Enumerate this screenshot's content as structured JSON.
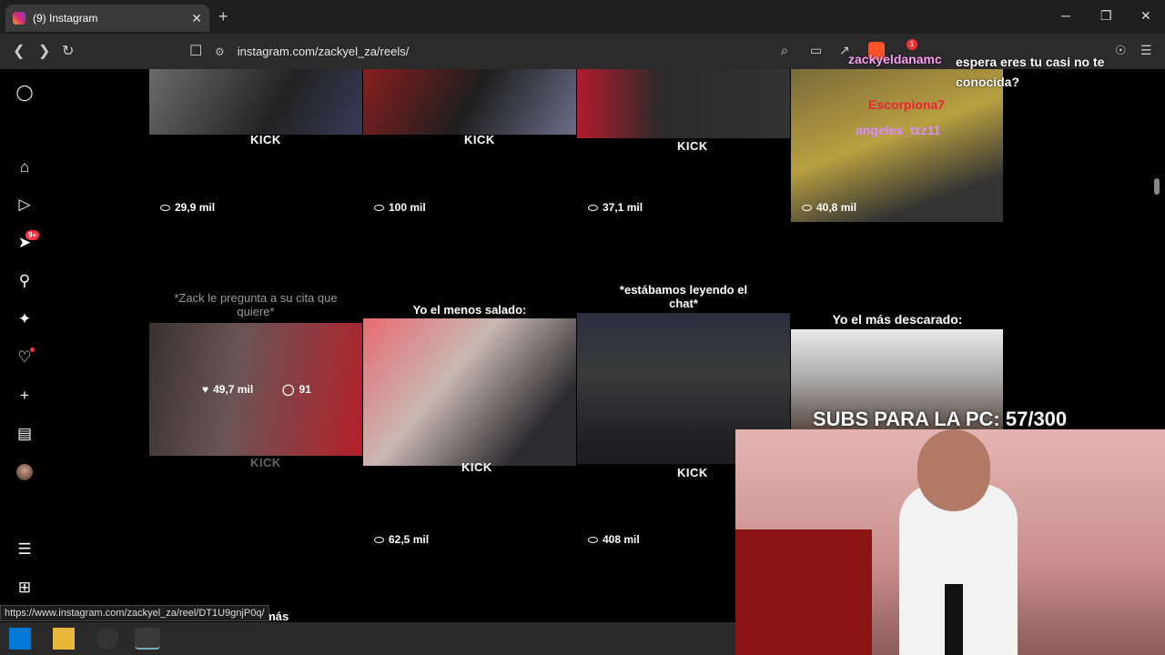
{
  "browser": {
    "tab_title": "(9) Instagram",
    "tab_close": "✕",
    "new_tab": "+",
    "url": "instagram.com/zackyel_za/reels/",
    "status_url": "https://www.instagram.com/zackyel_za/reel/DT1U9gnjP0q/",
    "ext_badge": "1",
    "win_min": "─",
    "win_max": "❐",
    "win_close": "✕"
  },
  "sidebar": {
    "notification_count": "9+",
    "icons": [
      "instagram-icon",
      "home-icon",
      "reels-icon",
      "messages-icon",
      "search-icon",
      "explore-icon",
      "notifications-icon",
      "create-icon",
      "dashboard-icon",
      "profile-avatar",
      "menu-icon",
      "also-from-meta-icon"
    ]
  },
  "grid": {
    "row1": [
      {
        "views": "29,9 mil",
        "brand": "KICK"
      },
      {
        "views": "100 mil",
        "brand": "KICK"
      },
      {
        "views": "37,1 mil",
        "brand": "KICK"
      },
      {
        "views": "40,8 mil"
      }
    ],
    "row2": [
      {
        "caption": "*Zack le pregunta a su cita que quiere*",
        "likes": "49,7 mil",
        "comments": "91",
        "brand": "KICK"
      },
      {
        "caption": "Yo el menos salado:",
        "views": "62,5 mil",
        "brand": "KICK"
      },
      {
        "caption": "*estábamos leyendo el chat*",
        "views": "408 mil",
        "brand": "KICK"
      },
      {
        "caption": "Yo el más descarado:"
      }
    ],
    "row3_partial": "l más"
  },
  "overlay": {
    "chat_user": "zackyeldanamc",
    "chat_message": "espera eres tu casi no te conocida?",
    "chat_name_1": "Escorpiona7",
    "chat_name_2": "angeles_tzz11",
    "subs_text": "SUBS PARA LA PC: 57/300"
  },
  "colors": {
    "chat_user": "#ff9ef2",
    "notification": "#ff3040",
    "chat_name_2": "#d88cff"
  }
}
